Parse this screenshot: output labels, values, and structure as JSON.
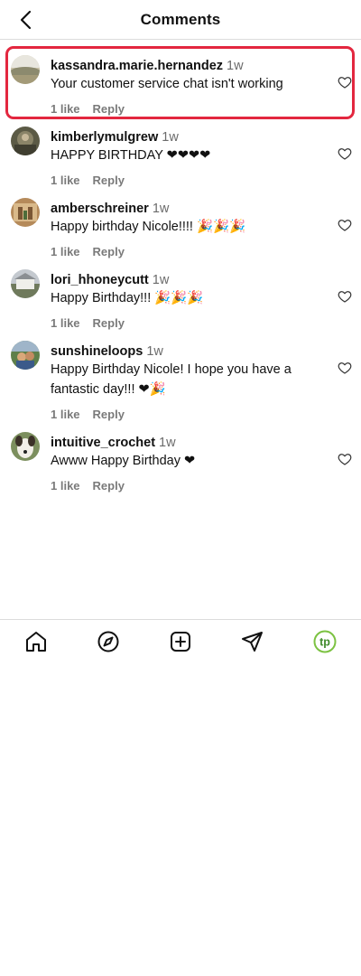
{
  "header": {
    "title": "Comments",
    "back_icon": "chevron-left-icon"
  },
  "comments": [
    {
      "username": "kassandra.marie.hernandez",
      "time": "1w",
      "text": "Your customer service chat isn't working",
      "likes": "1 like",
      "reply": "Reply",
      "highlighted": true
    },
    {
      "username": "kimberlymulgrew",
      "time": "1w",
      "text": "HAPPY BIRTHDAY ❤❤❤❤",
      "likes": "1 like",
      "reply": "Reply"
    },
    {
      "username": "amberschreiner",
      "time": "1w",
      "text": "Happy birthday Nicole!!!! 🎉🎉🎉",
      "likes": "1 like",
      "reply": "Reply"
    },
    {
      "username": "lori_hhoneycutt",
      "time": "1w",
      "text": "Happy Birthday!!! 🎉🎉🎉",
      "likes": "1 like",
      "reply": "Reply"
    },
    {
      "username": "sunshineloops",
      "time": "1w",
      "text": "Happy Birthday Nicole! I hope you have a fantastic day!!! ❤🎉",
      "likes": "1 like",
      "reply": "Reply"
    },
    {
      "username": "intuitive_crochet",
      "time": "1w",
      "text": "Awww Happy Birthday ❤",
      "likes": "1 like",
      "reply": "Reply"
    }
  ],
  "bottom_nav": {
    "items": [
      "home-icon",
      "explore-compass-icon",
      "create-plus-icon",
      "direct-send-icon",
      "profile-avatar-icon"
    ],
    "profile_initials": "tp",
    "accent_color": "#7cc242",
    "highlight_color": "#e3273f"
  }
}
